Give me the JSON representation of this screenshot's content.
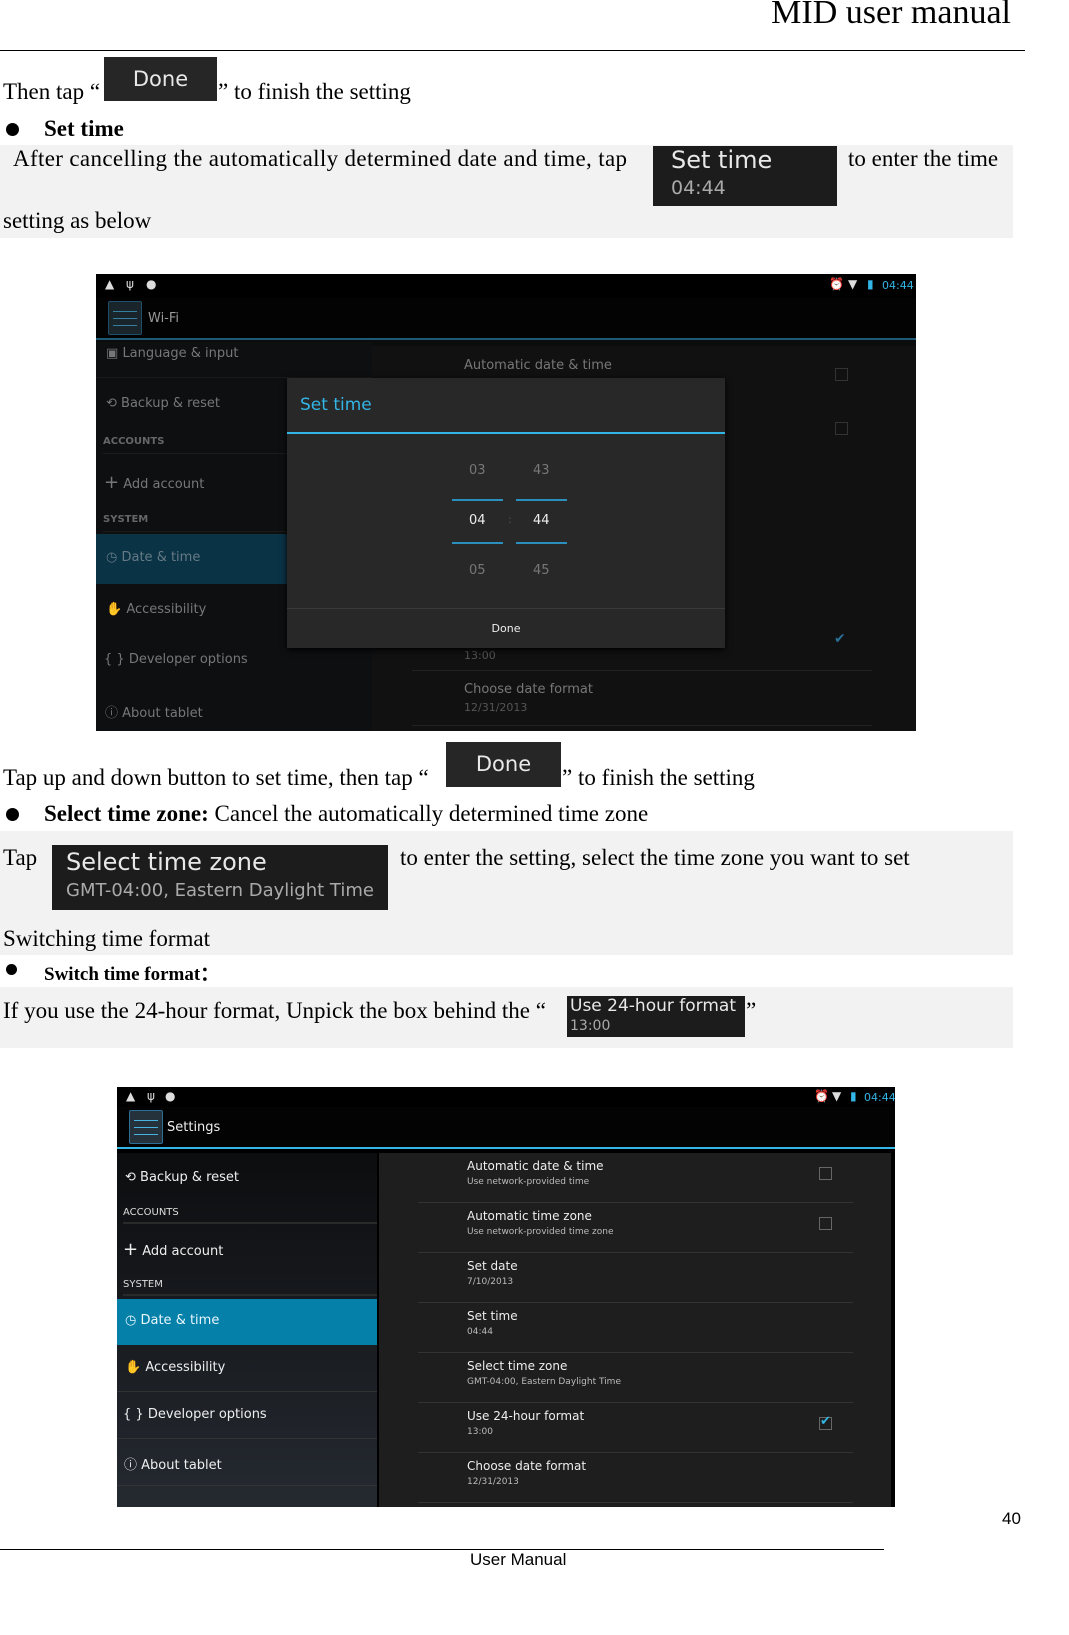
{
  "header": {
    "title": "MID user manual"
  },
  "para1": {
    "before": "Then tap “",
    "button": "Done",
    "after": "” to finish the setting"
  },
  "bullet1": {
    "label": "Set time"
  },
  "para2": {
    "text": "After cancelling the automatically determined date and time, tap",
    "chip_title": "Set time",
    "chip_value": "04:44",
    "after": "to enter the time",
    "line2": "setting as below"
  },
  "shot1": {
    "status_time": "04:44",
    "action_title": "Wi-Fi",
    "left": [
      {
        "label": "Language & input",
        "icon": "language-icon"
      },
      {
        "label": "Backup & reset",
        "icon": "backup-icon"
      },
      {
        "header": "ACCOUNTS"
      },
      {
        "label": "Add account",
        "icon": "plus-icon"
      },
      {
        "header": "SYSTEM"
      },
      {
        "label": "Date & time",
        "icon": "clock-icon",
        "selected": true
      },
      {
        "label": "Accessibility",
        "icon": "hand-icon"
      },
      {
        "label": "Developer options",
        "icon": "braces-icon"
      },
      {
        "label": "About tablet",
        "icon": "info-icon"
      }
    ],
    "right": {
      "row1": "Automatic date & time",
      "row_24_sub": "13:00",
      "row_date_title": "Choose date format",
      "row_date_sub": "12/31/2013"
    },
    "dialog": {
      "title": "Set time",
      "hour_prev": "03",
      "hour": "04",
      "hour_next": "05",
      "min_prev": "43",
      "min": "44",
      "min_next": "45",
      "sep": ":",
      "done": "Done"
    }
  },
  "para3": {
    "before": "Tap up and down button to set time, then tap “",
    "button": "Done",
    "after": "” to finish the setting"
  },
  "bullet2": {
    "label": "Select time zone:",
    "text": " Cancel the automatically determined time zone"
  },
  "para4": {
    "tap": "Tap",
    "chip_title": "Select time zone",
    "chip_value": "GMT-04:00, Eastern Daylight Time",
    "after": "to enter the setting, select the time zone you want to set",
    "line2": "Switching time format"
  },
  "bullet3": {
    "label": "Switch time format："
  },
  "para5": {
    "before": "If you use the 24-hour format, Unpick the box behind the “",
    "chip_title": "Use 24-hour format",
    "chip_value": "13:00",
    "after": "”"
  },
  "shot2": {
    "status_time": "04:44",
    "action_title": "Settings",
    "left": {
      "backup": "Backup & reset",
      "accounts": "ACCOUNTS",
      "add": "Add account",
      "system": "SYSTEM",
      "date": "Date & time",
      "access": "Accessibility",
      "dev": "Developer options",
      "about": "About tablet"
    },
    "rows": [
      {
        "title": "Automatic date & time",
        "sub": "Use network-provided time",
        "checkbox": false
      },
      {
        "title": "Automatic time zone",
        "sub": "Use network-provided time zone",
        "checkbox": false
      },
      {
        "title": "Set date",
        "sub": "7/10/2013"
      },
      {
        "title": "Set time",
        "sub": "04:44"
      },
      {
        "title": "Select time zone",
        "sub": "GMT-04:00, Eastern Daylight Time"
      },
      {
        "title": "Use 24-hour format",
        "sub": "13:00",
        "checkbox": true
      },
      {
        "title": "Choose date format",
        "sub": "12/31/2013"
      }
    ]
  },
  "colors": {
    "accent": "#33b5e5",
    "selected": "#0580a9",
    "selected_dim": "#0a3346"
  },
  "footer": {
    "page": "40",
    "label": "User Manual"
  }
}
